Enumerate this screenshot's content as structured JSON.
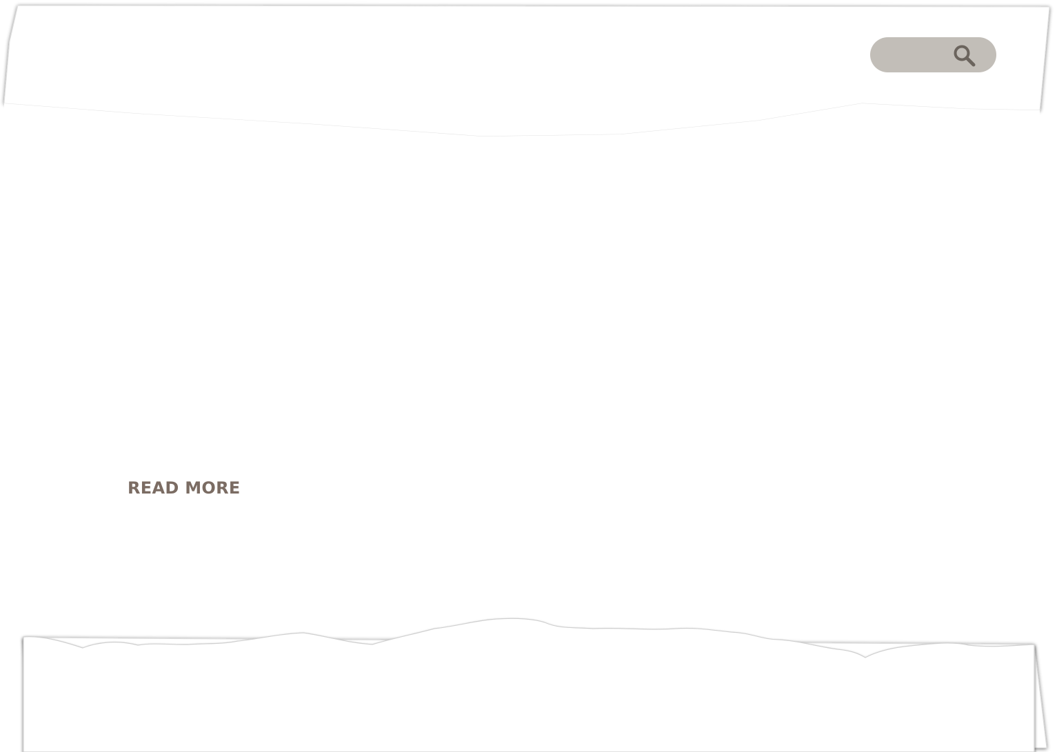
{
  "search": {
    "value": "",
    "placeholder": "",
    "icon": "search-icon",
    "background_color": "#c2beb8",
    "icon_color": "#6b645d"
  },
  "content": {
    "read_more_label": "READ MORE",
    "read_more_color": "#7b6c63"
  }
}
